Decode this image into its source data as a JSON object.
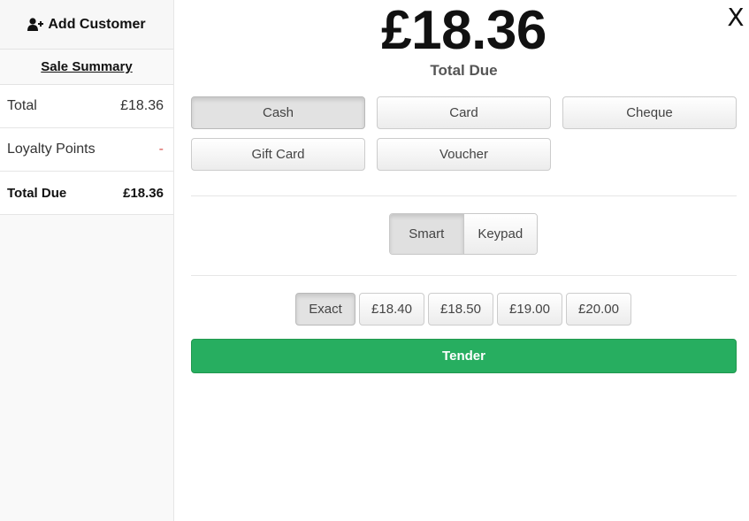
{
  "sidebar": {
    "add_customer_label": "Add Customer",
    "summary_title": "Sale Summary",
    "rows": [
      {
        "label": "Total",
        "value": "£18.36"
      },
      {
        "label": "Loyalty Points",
        "value": "-"
      },
      {
        "label": "Total Due",
        "value": "£18.36"
      }
    ]
  },
  "main": {
    "total_amount": "£18.36",
    "total_label": "Total Due",
    "close_label": "X",
    "payment_methods": [
      "Cash",
      "Card",
      "Cheque",
      "Gift Card",
      "Voucher"
    ],
    "selected_payment_method": "Cash",
    "modes": [
      "Smart",
      "Keypad"
    ],
    "selected_mode": "Smart",
    "quick_amounts": [
      "Exact",
      "£18.40",
      "£18.50",
      "£19.00",
      "£20.00"
    ],
    "selected_quick_amount": "Exact",
    "tender_label": "Tender"
  },
  "colors": {
    "tender": "#27ae60",
    "loyalty_value": "#d9534f",
    "sidebar_bg": "#f9f9f9"
  },
  "icons": {
    "add_customer": "user-plus-icon"
  }
}
